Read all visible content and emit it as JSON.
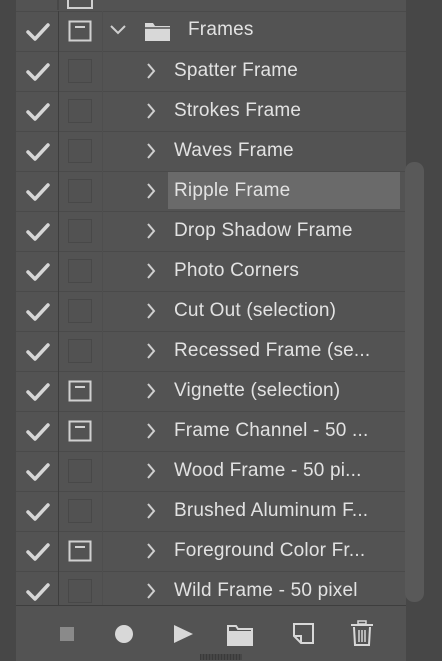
{
  "folder": {
    "name": "Frames",
    "checked": true,
    "has_dialog": true,
    "expanded": true
  },
  "actions": [
    {
      "name": "Spatter Frame",
      "checked": true,
      "has_dialog": false,
      "selected": false
    },
    {
      "name": "Strokes Frame",
      "checked": true,
      "has_dialog": false,
      "selected": false
    },
    {
      "name": "Waves Frame",
      "checked": true,
      "has_dialog": false,
      "selected": false
    },
    {
      "name": "Ripple Frame",
      "checked": true,
      "has_dialog": false,
      "selected": true
    },
    {
      "name": "Drop Shadow Frame",
      "checked": true,
      "has_dialog": false,
      "selected": false
    },
    {
      "name": "Photo Corners",
      "checked": true,
      "has_dialog": false,
      "selected": false
    },
    {
      "name": "Cut Out (selection)",
      "checked": true,
      "has_dialog": false,
      "selected": false
    },
    {
      "name": "Recessed Frame (se...",
      "checked": true,
      "has_dialog": false,
      "selected": false
    },
    {
      "name": "Vignette (selection)",
      "checked": true,
      "has_dialog": true,
      "selected": false
    },
    {
      "name": "Frame Channel - 50 ...",
      "checked": true,
      "has_dialog": true,
      "selected": false
    },
    {
      "name": "Wood Frame - 50 pi...",
      "checked": true,
      "has_dialog": false,
      "selected": false
    },
    {
      "name": "Brushed Aluminum F...",
      "checked": true,
      "has_dialog": false,
      "selected": false
    },
    {
      "name": "Foreground Color Fr...",
      "checked": true,
      "has_dialog": true,
      "selected": false
    },
    {
      "name": "Wild Frame - 50 pixel",
      "checked": true,
      "has_dialog": false,
      "selected": false
    }
  ],
  "footer_buttons": [
    "stop-icon",
    "record-icon",
    "play-icon",
    "new-set-icon",
    "new-action-icon",
    "delete-icon"
  ],
  "colors": {
    "panel": "#535353",
    "selected": "#6a6a6a",
    "text": "#e2e2e2",
    "icon": "#d0d0d0"
  }
}
